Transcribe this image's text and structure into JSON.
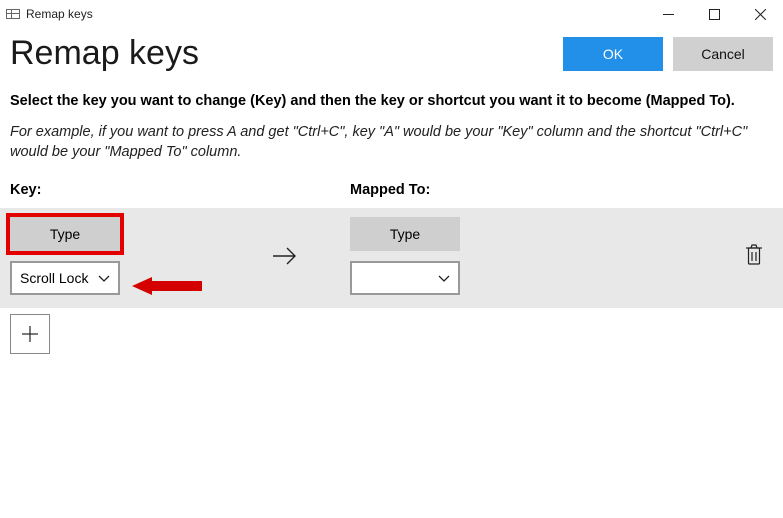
{
  "window": {
    "title": "Remap keys"
  },
  "header": {
    "page_title": "Remap keys",
    "ok_label": "OK",
    "cancel_label": "Cancel"
  },
  "instructions": {
    "line1": "Select the key you want to change (Key) and then the key or shortcut you want it to become (Mapped To).",
    "line2": "For example, if you want to press A and get \"Ctrl+C\", key \"A\" would be your \"Key\" column and the shortcut \"Ctrl+C\" would be your \"Mapped To\" column."
  },
  "columns": {
    "key_label": "Key:",
    "mapped_label": "Mapped To:"
  },
  "row": {
    "key_type_label": "Type",
    "key_selected": "Scroll Lock",
    "mapped_type_label": "Type",
    "mapped_selected": ""
  }
}
